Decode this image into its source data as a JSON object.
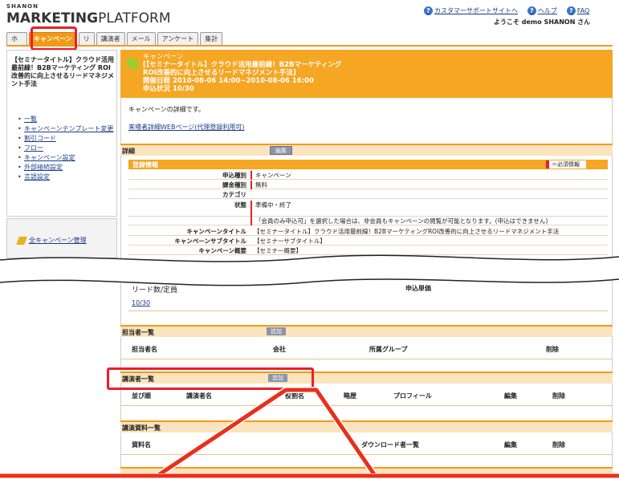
{
  "header": {
    "brand_small": "SHANON",
    "brand_main": "MARKETING",
    "brand_rest": "PLATFORM",
    "links": [
      {
        "label": "カスタマーサポートサイトへ",
        "icon": "question-icon"
      },
      {
        "label": "ヘルプ",
        "icon": "question-icon"
      },
      {
        "label": "FAQ",
        "icon": "question-icon"
      }
    ],
    "welcome": "ようこそ demo SHANON さん"
  },
  "tabs": [
    {
      "label": "ホーム",
      "active": false
    },
    {
      "label": "キャンペーン",
      "active": true
    },
    {
      "label": "リード",
      "active": false
    },
    {
      "label": "講演者",
      "active": false
    },
    {
      "label": "メール",
      "active": false
    },
    {
      "label": "アンケート",
      "active": false
    },
    {
      "label": "集計",
      "active": false
    }
  ],
  "sidebar": {
    "title": "【セミナータイトル】クラウド活用最前線！B2Bマーケティング ROI改善的に向上させるリードマネジメント手法",
    "items": [
      {
        "label": "一覧"
      },
      {
        "label": "キャンペーンテンプレート変更"
      },
      {
        "label": "割引コード"
      },
      {
        "label": "フロー"
      },
      {
        "label": "キャンペーン設定"
      },
      {
        "label": "外部接続設定"
      },
      {
        "label": "言語設定"
      }
    ],
    "all_campaigns": "全キャンペーン管理"
  },
  "banner": {
    "kind": "キャンペーン",
    "title": "[【セミナータイトル】クラウド活用最前線！B2Bマーケティング",
    "title2": "ROI改善的に向上させるリードマネジメント手法]",
    "date": "開催日程 2010-08-06 14:00~2010-08-06 16:00",
    "status": "申込状況 10/30"
  },
  "main": {
    "intro": "キャンペーンの詳細です。",
    "web_link": "来場者詳細WEBページ(代理登録利用可)",
    "detail_title": "詳細",
    "edit_label": "編集",
    "reg_title": "登録情報",
    "required_tag": "＝必須情報",
    "fields": [
      {
        "label": "申込種別",
        "value": "キャンペーン",
        "required": true
      },
      {
        "label": "課金種別",
        "value": "無料",
        "required": true
      },
      {
        "label": "カテゴリ",
        "value": "",
        "required": false
      },
      {
        "label": "状態",
        "value": "準備中・終了",
        "required": true
      },
      {
        "label": "",
        "value": "「会員のみ申込可」を選択した場合は、非会員もキャンペーンの閲覧が可能となります。(申込はできません)",
        "required": true
      },
      {
        "label": "キャンペーンタイトル",
        "value": "【セミナータイトル】クラウド活用最前線！B2BマーケティングROI改善的に向上させるリードマネジメント手法",
        "required": false
      },
      {
        "label": "キャンペーンサブタイトル",
        "value": "【セミナーサブタイトル】",
        "required": false
      },
      {
        "label": "キャンペーン概要",
        "value": "【セミナー概要】",
        "required": false
      }
    ]
  },
  "capacity": {
    "col1": "リード数/定員",
    "col2": "申込単価",
    "value": "10/30"
  },
  "staff": {
    "title": "担当者一覧",
    "add_label": "追加",
    "cols": [
      "担当者名",
      "会社",
      "所属グループ",
      "削除"
    ]
  },
  "lecturers": {
    "title": "講演者一覧",
    "add_label": "追加",
    "cols": [
      "並び順",
      "講演者名",
      "役割名",
      "略歴",
      "プロフィール",
      "編集",
      "削除"
    ]
  },
  "materials": {
    "title": "講演資料一覧",
    "cols": [
      "資料名",
      "ダウンロード者一覧",
      "編集",
      "削除"
    ]
  },
  "colors": {
    "accent": "#f29a18",
    "highlight": "#e8202a",
    "link": "#1a3c8a"
  }
}
